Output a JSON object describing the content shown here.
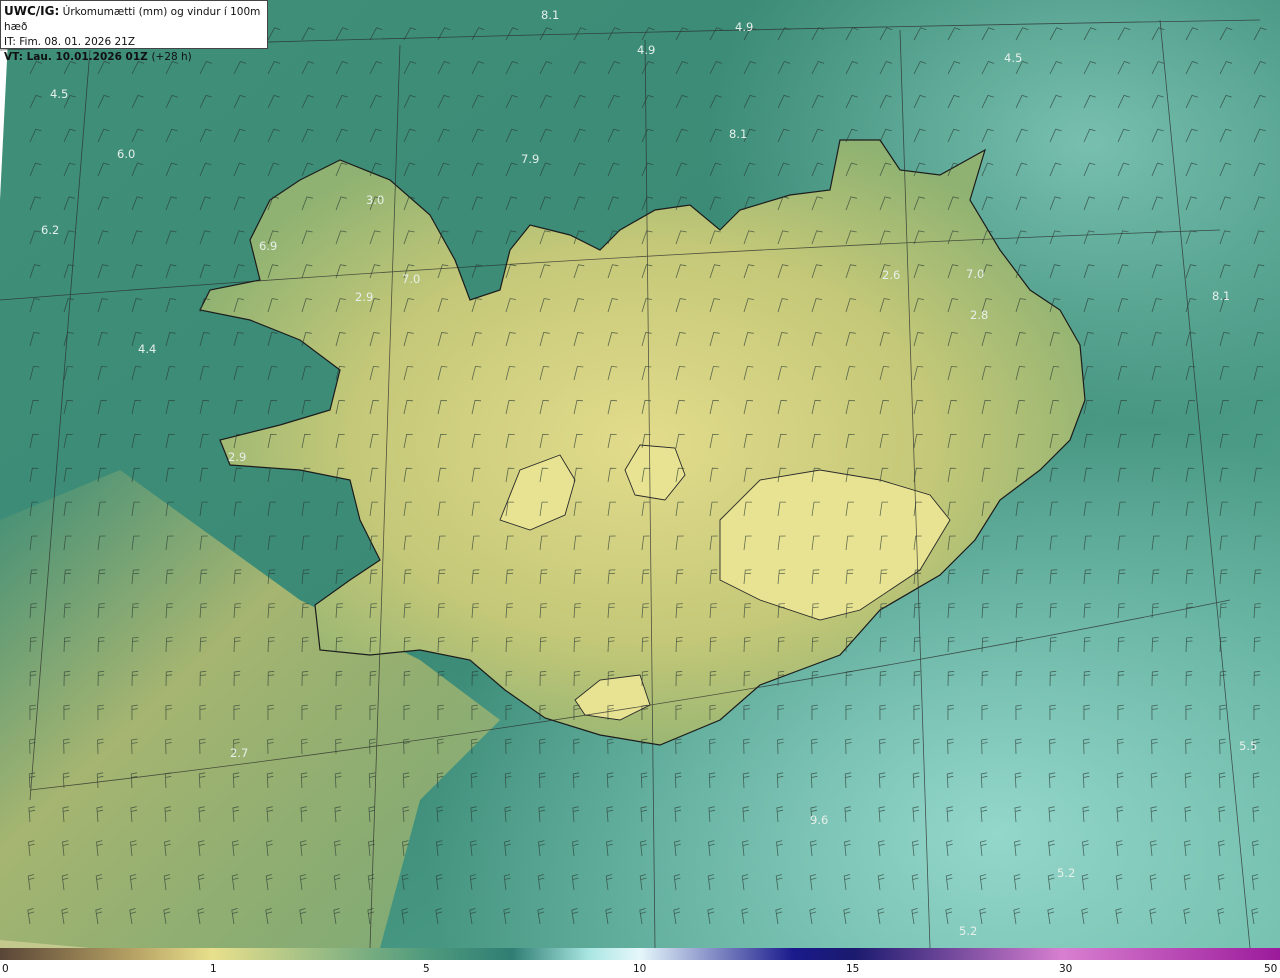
{
  "header": {
    "code": "UWC/IG:",
    "title": "Úrkomumætti (mm) og vindur í 100m hæð",
    "issue_prefix": "IT:",
    "issue_time": "Fim. 08. 01. 2026 21Z",
    "valid_prefix": "VT:",
    "valid_time": "Lau. 10.01.2026 01Z",
    "lead_time": "(+28 h)"
  },
  "map_values": [
    "8.1",
    "4.9",
    "4.9",
    "4.5",
    "4.5",
    "6.0",
    "8.1",
    "7.9",
    "6.2",
    "3.0",
    "6.9",
    "7.0",
    "2.9",
    "2.6",
    "7.0",
    "2.8",
    "8.1",
    "4.4",
    "2.9",
    "2.7",
    "5.5",
    "9.6",
    "5.2",
    "5.2"
  ],
  "colorbar": {
    "ticks": [
      "0",
      "1",
      "5",
      "10",
      "15",
      "30",
      "50"
    ],
    "colors": [
      "#5a4637",
      "#b39e62",
      "#e8e08c",
      "#4f9a7d",
      "#2f7e73",
      "#a9e6e2",
      "#e6f7fb",
      "#1a1a8c",
      "#1a1a6e",
      "#d87fd0",
      "#9b1a9b"
    ]
  },
  "colors": {
    "ocean": "#3e8f7a",
    "land": "#c9cd79",
    "coast": "#1c1c1c"
  }
}
